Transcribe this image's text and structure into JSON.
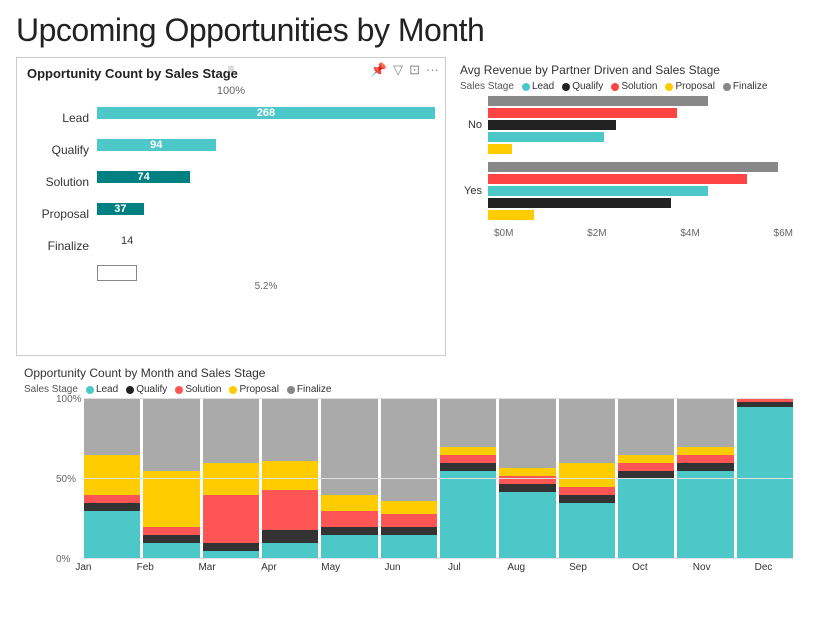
{
  "title": "Upcoming Opportunities by Month",
  "top_left": {
    "title": "Opportunity Count by Sales Stage",
    "pct_top": "100%",
    "pct_bottom": "5.2%",
    "bars": [
      {
        "label": "Lead",
        "value": 268,
        "pct": 100,
        "color": "#4DC8C8",
        "show_inside": true
      },
      {
        "label": "Qualify",
        "value": 94,
        "pct": 35,
        "color": "#4DC8C8",
        "show_inside": true
      },
      {
        "label": "Solution",
        "value": 74,
        "pct": 28,
        "color": "#008080",
        "show_inside": true
      },
      {
        "label": "Proposal",
        "value": 37,
        "pct": 14,
        "color": "#008080",
        "show_inside": true
      },
      {
        "label": "Finalize",
        "value": 14,
        "pct": 5,
        "color": "#7DD9D9",
        "show_inside": false
      }
    ]
  },
  "top_right": {
    "title": "Avg Revenue by Partner Driven and Sales Stage",
    "legend_label": "Sales Stage",
    "legend_items": [
      {
        "label": "Lead",
        "color": "#4DC8C8"
      },
      {
        "label": "Qualify",
        "color": "#222222"
      },
      {
        "label": "Solution",
        "color": "#FF4444"
      },
      {
        "label": "Proposal",
        "color": "#FFCC00"
      },
      {
        "label": "Finalize",
        "color": "#888888"
      }
    ],
    "rows": [
      {
        "label": "No",
        "bars": [
          {
            "color": "#888888",
            "pct": 72
          },
          {
            "color": "#FF4444",
            "pct": 62
          },
          {
            "color": "#222222",
            "pct": 42
          },
          {
            "color": "#4DC8C8",
            "pct": 38
          },
          {
            "color": "#FFCC00",
            "pct": 8
          }
        ]
      },
      {
        "label": "Yes",
        "bars": [
          {
            "color": "#888888",
            "pct": 95
          },
          {
            "color": "#FF4444",
            "pct": 85
          },
          {
            "color": "#4DC8C8",
            "pct": 72
          },
          {
            "color": "#222222",
            "pct": 60
          },
          {
            "color": "#FFCC00",
            "pct": 15
          }
        ]
      }
    ],
    "x_labels": [
      "$0M",
      "$2M",
      "$4M",
      "$6M"
    ]
  },
  "bottom": {
    "title": "Opportunity Count by Month and Sales Stage",
    "legend_label": "Sales Stage",
    "legend_items": [
      {
        "label": "Lead",
        "color": "#4DC8C8"
      },
      {
        "label": "Qualify",
        "color": "#222222"
      },
      {
        "label": "Solution",
        "color": "#FF5555"
      },
      {
        "label": "Proposal",
        "color": "#FFCC00"
      },
      {
        "label": "Finalize",
        "color": "#888888"
      }
    ],
    "y_labels": [
      "100%",
      "50%",
      "0%"
    ],
    "months": [
      "Jan",
      "Feb",
      "Mar",
      "Apr",
      "May",
      "Jun",
      "Jul",
      "Aug",
      "Sep",
      "Oct",
      "Nov",
      "Dec"
    ],
    "data": [
      {
        "month": "Jan",
        "lead": 30,
        "qualify": 5,
        "solution": 5,
        "proposal": 25,
        "finalize": 35
      },
      {
        "month": "Feb",
        "lead": 10,
        "qualify": 5,
        "solution": 5,
        "proposal": 35,
        "finalize": 45
      },
      {
        "month": "Mar",
        "lead": 5,
        "qualify": 5,
        "solution": 30,
        "proposal": 20,
        "finalize": 40
      },
      {
        "month": "Apr",
        "lead": 10,
        "qualify": 8,
        "solution": 25,
        "proposal": 18,
        "finalize": 39
      },
      {
        "month": "May",
        "lead": 15,
        "qualify": 5,
        "solution": 10,
        "proposal": 10,
        "finalize": 60
      },
      {
        "month": "Jun",
        "lead": 15,
        "qualify": 5,
        "solution": 8,
        "proposal": 8,
        "finalize": 64
      },
      {
        "month": "Jul",
        "lead": 55,
        "qualify": 5,
        "solution": 5,
        "proposal": 5,
        "finalize": 30
      },
      {
        "month": "Aug",
        "lead": 42,
        "qualify": 5,
        "solution": 5,
        "proposal": 5,
        "finalize": 43
      },
      {
        "month": "Sep",
        "lead": 35,
        "qualify": 5,
        "solution": 5,
        "proposal": 15,
        "finalize": 40
      },
      {
        "month": "Oct",
        "lead": 50,
        "qualify": 5,
        "solution": 5,
        "proposal": 5,
        "finalize": 35
      },
      {
        "month": "Nov",
        "lead": 55,
        "qualify": 5,
        "solution": 5,
        "proposal": 5,
        "finalize": 30
      },
      {
        "month": "Dec",
        "lead": 95,
        "qualify": 3,
        "solution": 2,
        "proposal": 0,
        "finalize": 0
      }
    ]
  },
  "colors": {
    "lead": "#4DC8C8",
    "qualify": "#333333",
    "solution": "#FF5555",
    "proposal": "#FFCC00",
    "finalize": "#AAAAAA"
  }
}
